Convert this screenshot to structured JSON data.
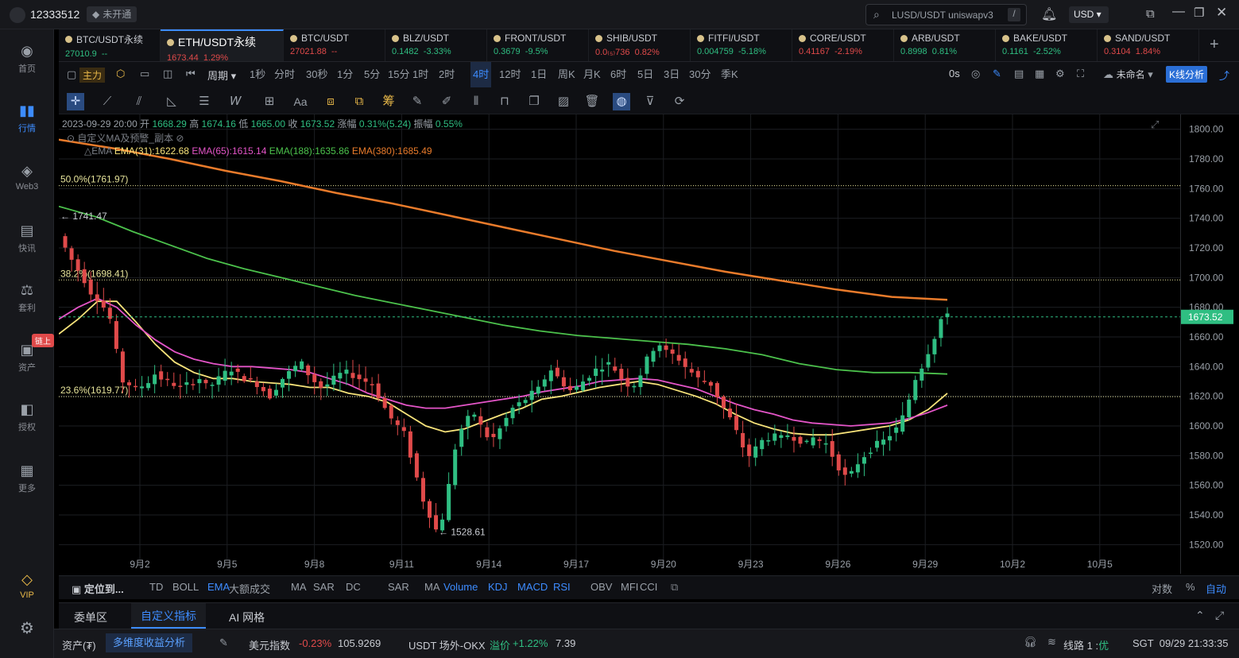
{
  "titlebar": {
    "account": "12333512",
    "badge": "未开通",
    "search_text": "LUSD/USDT uniswapv3",
    "search_key": "/",
    "currency": "USD"
  },
  "sidebar": [
    {
      "label": "首页",
      "icon": "planet-icon"
    },
    {
      "label": "行情",
      "icon": "bar-chart-icon",
      "active": true
    },
    {
      "label": "Web3",
      "icon": "web3-icon"
    },
    {
      "label": "快讯",
      "icon": "news-icon"
    },
    {
      "label": "套利",
      "icon": "arbitrage-icon"
    },
    {
      "label": "资产",
      "icon": "wallet-icon",
      "badge": "链上"
    },
    {
      "label": "授权",
      "icon": "authorize-icon"
    },
    {
      "label": "更多",
      "icon": "grid-icon"
    },
    {
      "label": "VIP",
      "icon": "vip-diamond-icon"
    }
  ],
  "tabs": [
    {
      "name": "BTC/USDT永续",
      "price": "27010.9",
      "change": "--",
      "color": "green"
    },
    {
      "name": "ETH/USDT永续",
      "price": "1673.44",
      "change": "1.29%",
      "color": "red",
      "active": true
    },
    {
      "name": "BTC/USDT",
      "price": "27021.88",
      "change": "--",
      "color": "red"
    },
    {
      "name": "BLZ/USDT",
      "price": "0.1482",
      "change": "-3.33%",
      "color": "green"
    },
    {
      "name": "FRONT/USDT",
      "price": "0.3679",
      "change": "-9.5%",
      "color": "green"
    },
    {
      "name": "SHIB/USDT",
      "price": "0.0₍₅₎736",
      "change": "0.82%",
      "color": "red"
    },
    {
      "name": "FITFI/USDT",
      "price": "0.004759",
      "change": "-5.18%",
      "color": "green"
    },
    {
      "name": "CORE/USDT",
      "price": "0.41167",
      "change": "-2.19%",
      "color": "red"
    },
    {
      "name": "ARB/USDT",
      "price": "0.8998",
      "change": "0.81%",
      "color": "green"
    },
    {
      "name": "BAKE/USDT",
      "price": "0.1161",
      "change": "-2.52%",
      "color": "green"
    },
    {
      "name": "SAND/USDT",
      "price": "0.3104",
      "change": "1.84%",
      "color": "red"
    }
  ],
  "toolbar": {
    "main_label": "主力",
    "period_label": "周期",
    "intervals": [
      "1秒",
      "分时",
      "30秒",
      "1分",
      "5分",
      "15分",
      "1时",
      "2时",
      "4时",
      "12时",
      "1日",
      "周K",
      "月K",
      "6时",
      "5日",
      "3日",
      "30分",
      "季K"
    ],
    "active_interval": "4时",
    "countdown": "0s",
    "layout_name": "未命名",
    "kline_analysis": "K线分析"
  },
  "drawing_tools": [
    "crosshair-icon",
    "trend-line-icon",
    "ray-icon",
    "angle-icon",
    "parallel-lines-icon",
    "wave-icon",
    "measure-icon",
    "text-icon",
    "fib-icon",
    "gann-icon",
    "chip-icon",
    "pen-icon",
    "brush-icon",
    "pattern-icon",
    "lock-icon",
    "copy-icon",
    "edit-icon",
    "trash-icon",
    "magnet-icon",
    "filter-icon",
    "sync-icon"
  ],
  "ohlc": {
    "datetime": "2023-09-29 20:00",
    "open_label": "开",
    "open": "1668.29",
    "high_label": "高",
    "high": "1674.16",
    "low_label": "低",
    "low": "1665.00",
    "close_label": "收",
    "close": "1673.52",
    "chg_label": "涨幅",
    "chg": "0.31%(5.24)",
    "amp_label": "振幅",
    "amp": "0.55%"
  },
  "indicator_info": {
    "custom_label": "自定义MA及预警_副本",
    "ema_label": "EMA",
    "ema31": "EMA(31):1622.68",
    "ema65": "EMA(65):1615.14",
    "ema188": "EMA(188):1635.86",
    "ema380": "EMA(380):1685.49"
  },
  "fib": [
    {
      "label": "50.0%(1761.97)",
      "price": 1761.97
    },
    {
      "label": "38.2%(1698.41)",
      "price": 1698.41
    },
    {
      "label": "23.6%(1619.77)",
      "price": 1619.77
    }
  ],
  "markers": {
    "high": "← 1741.47",
    "low": "← 1528.61",
    "current_price": "1673.52"
  },
  "chart_data": {
    "type": "candlestick",
    "symbol": "ETH/USDT永续",
    "interval": "4时",
    "ylim": [
      1510,
      1810
    ],
    "yticks": [
      1800,
      1780,
      1760,
      1740,
      1720,
      1700,
      1680,
      1660,
      1640,
      1620,
      1600,
      1580,
      1560,
      1540,
      1520
    ],
    "xticks": [
      "9月2",
      "9月5",
      "9月8",
      "9月11",
      "9月14",
      "9月17",
      "9月20",
      "9月23",
      "9月26",
      "9月29",
      "10月2",
      "10月5"
    ],
    "close_path": [
      1728,
      1720,
      1712,
      1705,
      1698,
      1690,
      1686,
      1680,
      1672,
      1650,
      1630,
      1628,
      1625,
      1627,
      1630,
      1635,
      1632,
      1630,
      1628,
      1626,
      1628,
      1630,
      1632,
      1627,
      1628,
      1632,
      1636,
      1638,
      1635,
      1632,
      1630,
      1628,
      1624,
      1620,
      1626,
      1632,
      1636,
      1640,
      1642,
      1635,
      1630,
      1626,
      1628,
      1632,
      1635,
      1636,
      1634,
      1632,
      1630,
      1628,
      1620,
      1612,
      1605,
      1600,
      1595,
      1580,
      1565,
      1550,
      1540,
      1530,
      1538,
      1560,
      1585,
      1598,
      1605,
      1608,
      1600,
      1593,
      1592,
      1598,
      1605,
      1612,
      1615,
      1618,
      1622,
      1625,
      1632,
      1638,
      1633,
      1628,
      1624,
      1626,
      1630,
      1634,
      1638,
      1640,
      1642,
      1638,
      1632,
      1628,
      1628,
      1635,
      1645,
      1652,
      1655,
      1650,
      1648,
      1645,
      1640,
      1636,
      1632,
      1630,
      1628,
      1620,
      1612,
      1605,
      1596,
      1586,
      1580,
      1585,
      1590,
      1592,
      1593,
      1592,
      1594,
      1592,
      1590,
      1588,
      1592,
      1590,
      1588,
      1580,
      1572,
      1566,
      1568,
      1575,
      1580,
      1584,
      1588,
      1590,
      1594,
      1598,
      1606,
      1618,
      1632,
      1640,
      1650,
      1660,
      1672,
      1674
    ],
    "series": [
      {
        "name": "EMA(31)",
        "color": "#f7e37a",
        "values": [
          1662,
          1672,
          1684,
          1684,
          1670,
          1655,
          1643,
          1636,
          1632,
          1632,
          1630,
          1629,
          1628,
          1626,
          1626,
          1622,
          1620,
          1616,
          1608,
          1600,
          1596,
          1598,
          1603,
          1608,
          1612,
          1618,
          1620,
          1623,
          1626,
          1628,
          1630,
          1628,
          1624,
          1620,
          1615,
          1608,
          1602,
          1598,
          1595,
          1594,
          1594,
          1596,
          1598,
          1600,
          1604,
          1611,
          1622
        ]
      },
      {
        "name": "EMA(65)",
        "color": "#e455c8",
        "values": [
          1672,
          1680,
          1686,
          1680,
          1668,
          1658,
          1650,
          1645,
          1642,
          1640,
          1640,
          1639,
          1638,
          1636,
          1632,
          1628,
          1622,
          1618,
          1614,
          1612,
          1612,
          1614,
          1616,
          1618,
          1620,
          1623,
          1625,
          1627,
          1630,
          1631,
          1632,
          1631,
          1628,
          1625,
          1620,
          1615,
          1611,
          1608,
          1604,
          1602,
          1601,
          1600,
          1601,
          1602,
          1605,
          1609,
          1614
        ]
      },
      {
        "name": "EMA(188)",
        "color": "#4cc24c",
        "values": [
          1748,
          1741,
          1731,
          1722,
          1713,
          1706,
          1700,
          1694,
          1688,
          1683,
          1678,
          1673,
          1668,
          1664,
          1661,
          1659,
          1657,
          1655,
          1652,
          1648,
          1642,
          1638,
          1636,
          1636,
          1635
        ]
      },
      {
        "name": "EMA(380)",
        "color": "#e97b2b",
        "values": [
          1793,
          1787,
          1780,
          1772,
          1765,
          1757,
          1750,
          1742,
          1734,
          1726,
          1718,
          1711,
          1704,
          1698,
          1692,
          1687,
          1685
        ]
      }
    ]
  },
  "indicator_bar": {
    "locate": "定位到...",
    "main": [
      "TD",
      "BOLL",
      "EMA",
      "大额成交",
      "MA",
      "SAR",
      "DC"
    ],
    "main_active": "EMA",
    "sub": [
      "SAR",
      "MA",
      "Volume",
      "KDJ",
      "MACD",
      "RSI",
      "OBV",
      "MFI",
      "CCI"
    ],
    "sub_active": [
      "Volume",
      "KDJ",
      "MACD",
      "RSI"
    ],
    "right": [
      "对数",
      "%",
      "自动"
    ]
  },
  "bottom_tabs": {
    "items": [
      "委单区",
      "自定义指标",
      "AI 网格"
    ],
    "active": "自定义指标"
  },
  "status": {
    "asset": "资产(₮)",
    "multi": "多维度收益分析",
    "usd_index_label": "美元指数",
    "usd_index_change": "-0.23%",
    "usd_index_value": "105.9269",
    "otc_label": "USDT 场外-OKX",
    "premium_label": "溢价",
    "premium": "+1.22%",
    "otc_price": "7.39",
    "line_label": "线路 1 :",
    "line_quality": "优",
    "clock": "SGT  09/29 21:33:35"
  }
}
